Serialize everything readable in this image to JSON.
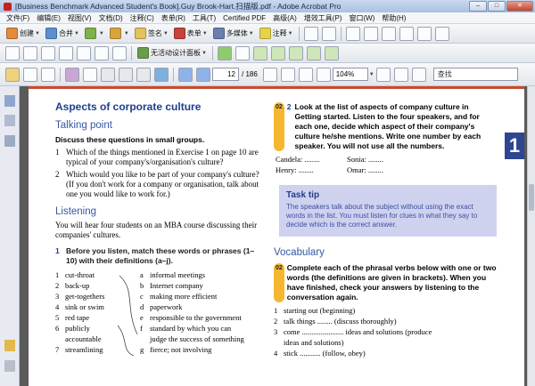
{
  "window": {
    "title": "[Business Benchmark Advanced Student's Book].Guy Brook-Hart.扫描版.pdf - Adobe Acrobat Pro",
    "controls": [
      "–",
      "□",
      "✕"
    ]
  },
  "menu": [
    "文件(F)",
    "编辑(E)",
    "视图(V)",
    "文档(D)",
    "注释(C)",
    "表单(R)",
    "工具(T)",
    "Certified PDF",
    "高级(A)",
    "增效工具(P)",
    "窗口(W)",
    "帮助(H)"
  ],
  "toolbar1": {
    "create": "创建",
    "combine": "合并",
    "sign": "签名",
    "forms": "表单",
    "multimedia": "多媒体",
    "comment": "注释"
  },
  "toolbar2": {
    "dropdown": "无活动设计面板"
  },
  "toolbar3": {
    "page_current": "12",
    "page_total": "/ 186",
    "zoom": "104%",
    "search_placeholder": "查找"
  },
  "page": {
    "section_tab": "1",
    "left": {
      "heading": "Aspects of corporate culture",
      "talking_point": "Talking point",
      "talking_instr": "Discuss these questions in small groups.",
      "q1": "Which of the things mentioned in Exercise 1 on page 10 are typical of your company's/organisation's culture?",
      "q2": "Which would you like to be part of your company's culture? (If you don't work for a company or organisation, talk about one you would like to work for.)",
      "listening": "Listening",
      "listening_intro": "You will hear four students on an MBA course discussing their companies' cultures.",
      "ex1_num": "1",
      "ex1_instr": "Before you listen, match these words or phrases (1–10) with their definitions (a–j).",
      "words": [
        "cut-throat",
        "back-up",
        "get-togethers",
        "sink or swim",
        "red tape",
        "publicly",
        "accountable",
        "streamlining"
      ],
      "word_nums": [
        "1",
        "2",
        "3",
        "4",
        "5",
        "6",
        "",
        "7"
      ],
      "defs": [
        "informal meetings",
        "Internet company",
        "making more efficient",
        "paperwork",
        "responsible to the government",
        "standard by which you can",
        "judge the success of something",
        "fierce; not involving"
      ],
      "def_letters": [
        "a",
        "b",
        "c",
        "d",
        "e",
        "f",
        "",
        "g"
      ]
    },
    "right": {
      "ex2_badge": "02",
      "ex2_num": "2",
      "ex2_text": "Look at the list of aspects of company culture in Getting started. Listen to the four speakers, and for each one, decide which aspect of their company's culture he/she mentions. Write one number by each speaker. You will not use all the numbers.",
      "people": [
        "Candela: ........",
        "Sonia: ........",
        "Henry: ........",
        "Omar: ........"
      ],
      "tasktip_title": "Task tip",
      "tasktip_body": "The speakers talk about the subject without using the exact words in the list. You must listen for clues in what they say to decide which is the correct answer.",
      "vocab": "Vocabulary",
      "vocab_badge": "02",
      "vocab_instr": "Complete each of the phrasal verbs below with one or two words (the definitions are given in brackets). When you have finished, check your answers by listening to the conversation again.",
      "items": [
        "starting out (beginning)",
        "talk things ........ (discuss thoroughly)",
        "come ...................... ideas and solutions (produce",
        "ideas and solutions)",
        "stick ........... (follow, obey)"
      ],
      "item_nums": [
        "1",
        "2",
        "3",
        "",
        "4"
      ]
    }
  }
}
